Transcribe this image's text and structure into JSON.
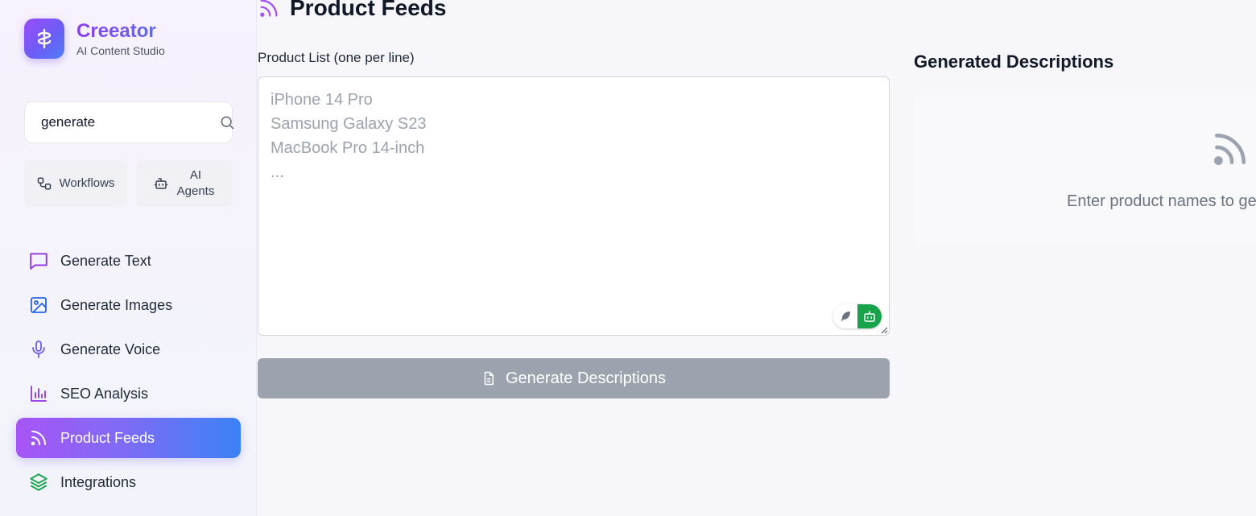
{
  "app": {
    "name": "Creeator",
    "subtitle": "AI Content Studio"
  },
  "sidebar": {
    "search": {
      "value": "generate",
      "placeholder": ""
    },
    "quick_actions": [
      {
        "label": "Workflows",
        "icon": "workflow-icon"
      },
      {
        "label": "AI Agents",
        "icon": "bot-icon"
      }
    ],
    "nav": [
      {
        "label": "Generate Text",
        "icon": "message-square-icon",
        "color": "#9333ea"
      },
      {
        "label": "Generate Images",
        "icon": "image-icon",
        "color": "#2563eb"
      },
      {
        "label": "Generate Voice",
        "icon": "microphone-icon",
        "color": "#6d5cf6"
      },
      {
        "label": "SEO Analysis",
        "icon": "bar-chart-icon",
        "color": "#9333ea"
      },
      {
        "label": "Product Feeds",
        "icon": "rss-icon",
        "active": true
      },
      {
        "label": "Integrations",
        "icon": "layers-icon",
        "color": "#16a34a"
      }
    ]
  },
  "main": {
    "page_title": "Product Feeds",
    "input_label": "Product List (one per line)",
    "textarea": {
      "value": "",
      "placeholder": "iPhone 14 Pro\nSamsung Galaxy S23\nMacBook Pro 14-inch\n..."
    },
    "generate_button": "Generate Descriptions",
    "results": {
      "title": "Generated Descriptions",
      "empty_text": "Enter product names to ge"
    }
  },
  "colors": {
    "accent_purple": "#a855f7",
    "accent_blue": "#3b82f6",
    "button_disabled": "#9ca3af",
    "extension_green": "#16a34a"
  }
}
